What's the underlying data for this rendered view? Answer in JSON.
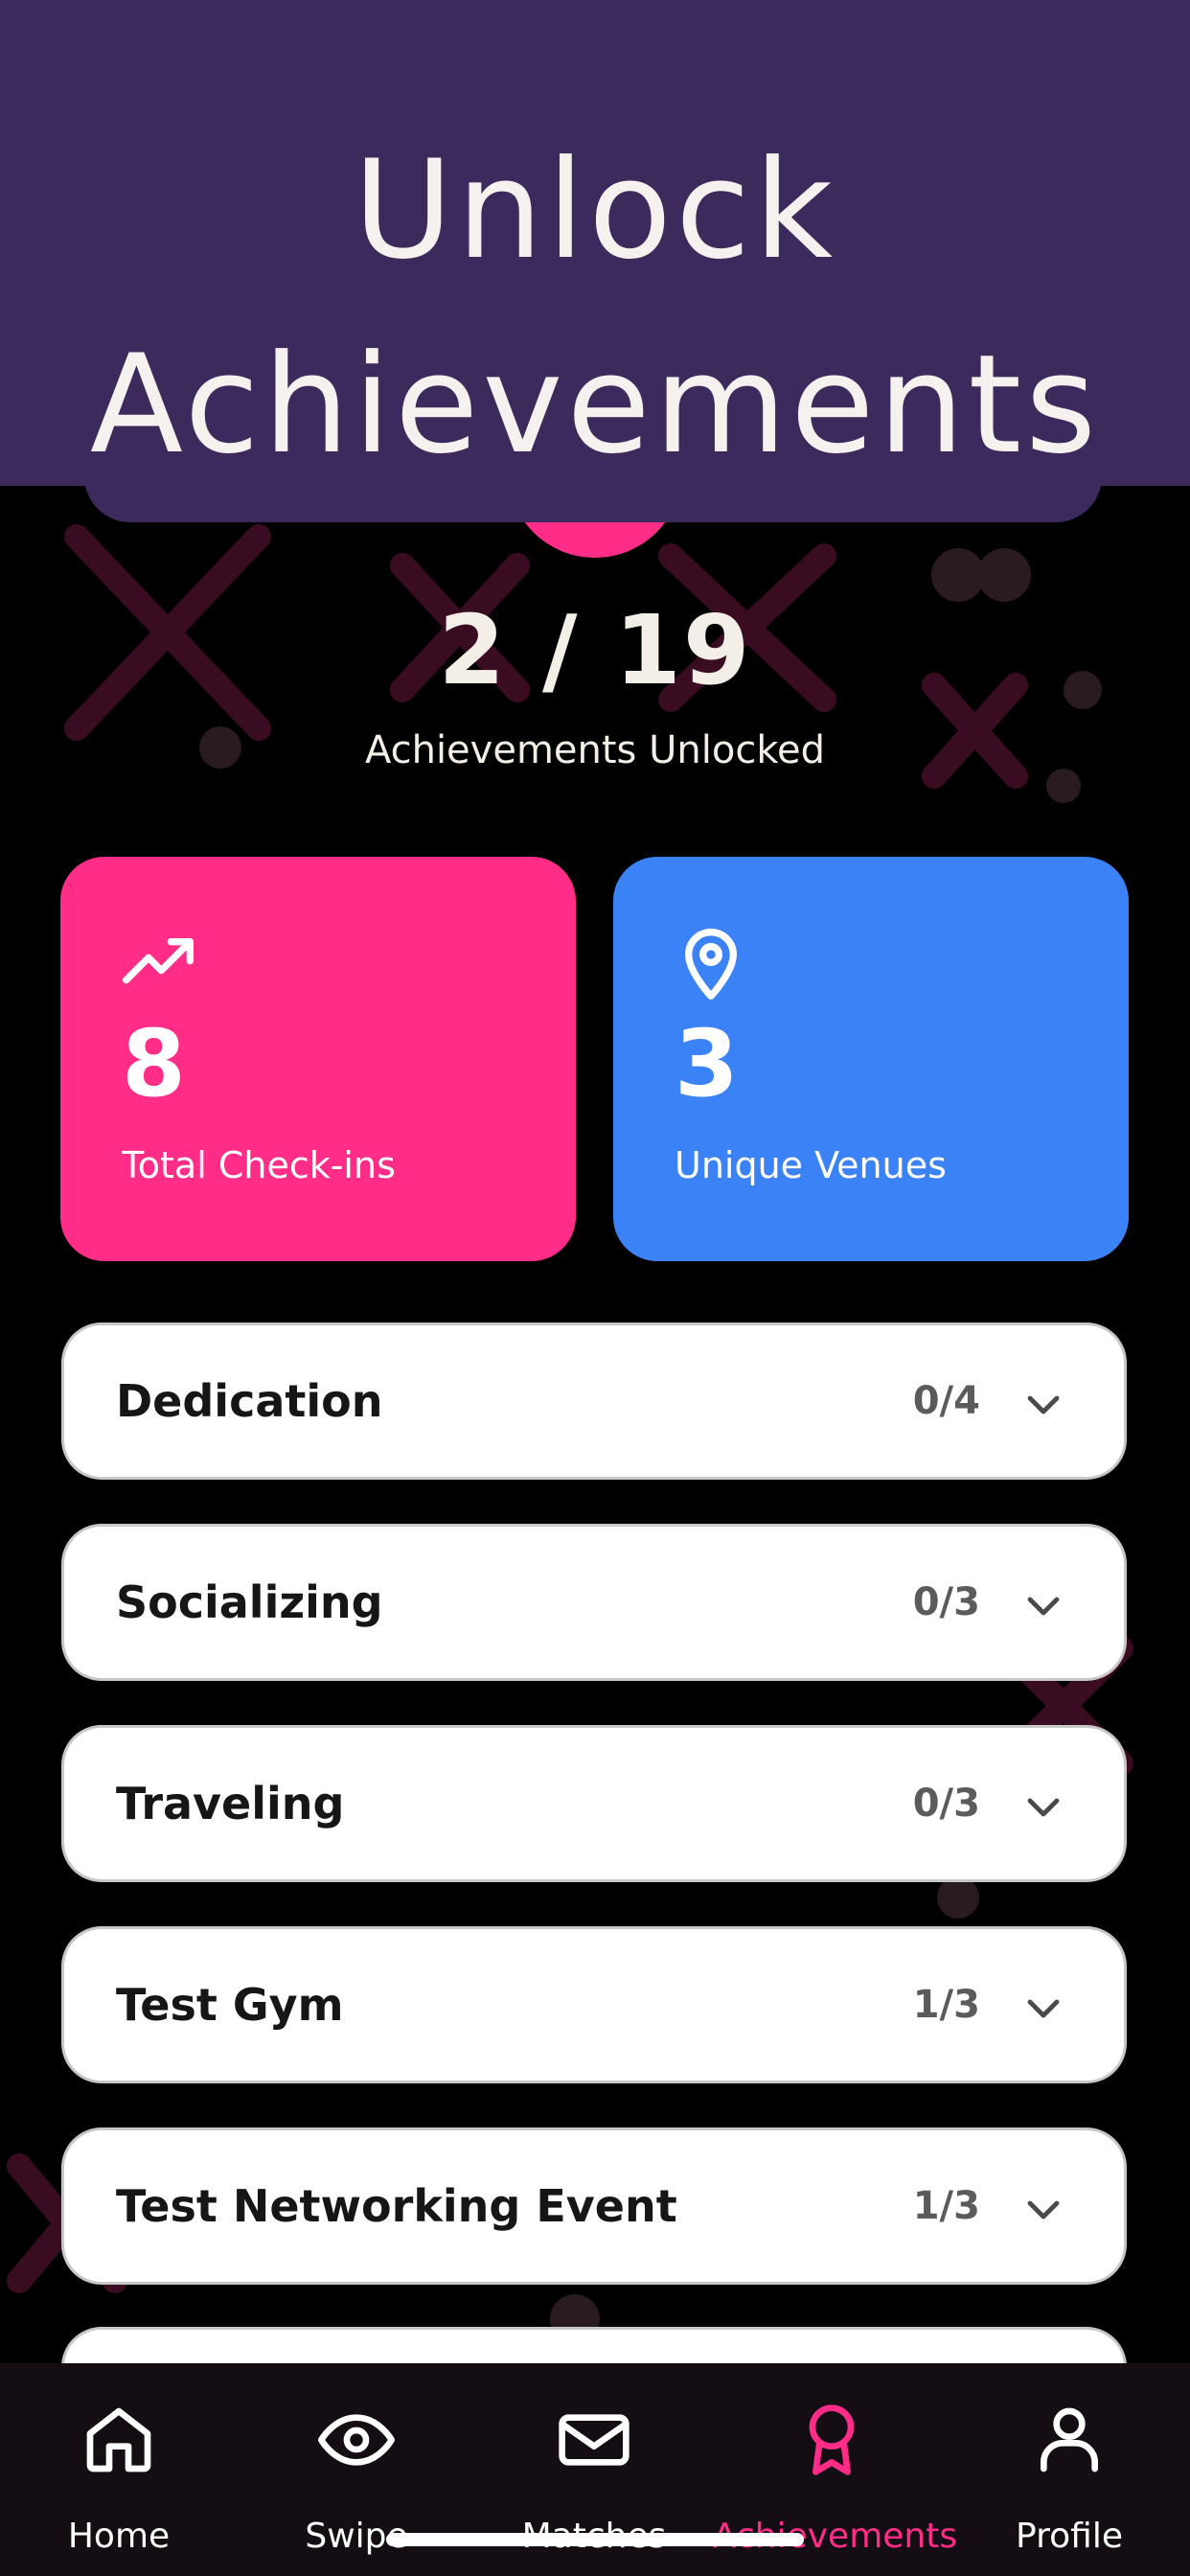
{
  "header": {
    "title_line1": "Unlock",
    "title_line2": "Achievements"
  },
  "progress": {
    "count": "2 / 19",
    "label": "Achievements Unlocked"
  },
  "stats": [
    {
      "value": "8",
      "label": "Total Check-ins",
      "icon": "trending-up-icon",
      "color": "#ff2d87"
    },
    {
      "value": "3",
      "label": "Unique Venues",
      "icon": "map-pin-icon",
      "color": "#3b82f6"
    }
  ],
  "categories": [
    {
      "name": "Dedication",
      "progress": "0/4"
    },
    {
      "name": "Socializing",
      "progress": "0/3"
    },
    {
      "name": "Traveling",
      "progress": "0/3"
    },
    {
      "name": "Test Gym",
      "progress": "1/3"
    },
    {
      "name": "Test Networking Event",
      "progress": "1/3"
    }
  ],
  "nav": [
    {
      "label": "Home",
      "icon": "home-icon",
      "active": false
    },
    {
      "label": "Swipe",
      "icon": "eye-icon",
      "active": false
    },
    {
      "label": "Matches",
      "icon": "mail-icon",
      "active": false
    },
    {
      "label": "Achievements",
      "icon": "award-icon",
      "active": true
    },
    {
      "label": "Profile",
      "icon": "user-icon",
      "active": false
    }
  ],
  "colors": {
    "accent": "#ff2d87",
    "header": "#3d2a5c",
    "blue": "#3b82f6",
    "nav_bg": "#150d14"
  }
}
